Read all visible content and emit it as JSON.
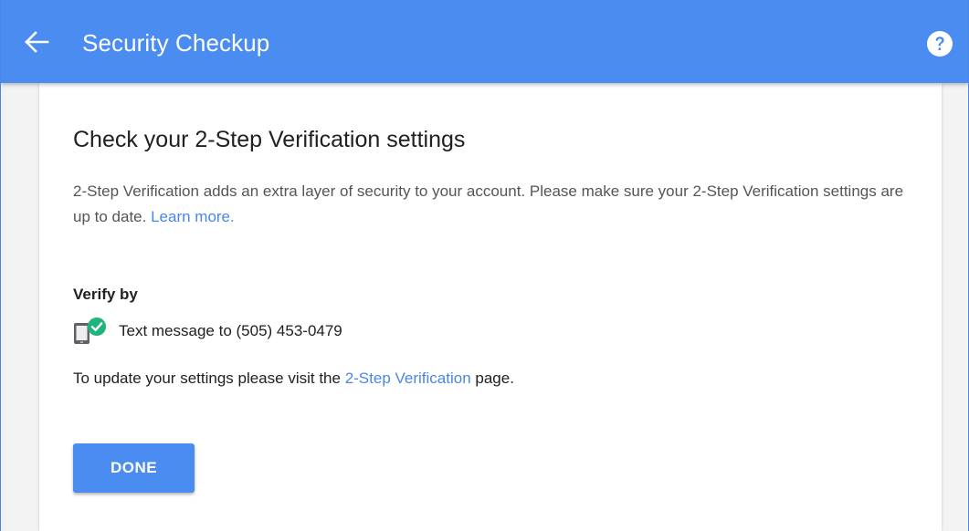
{
  "appbar": {
    "title": "Security Checkup",
    "back_icon": "arrow-left-icon",
    "help_icon": "help-circle-icon",
    "color": "#4b8cf0"
  },
  "card": {
    "heading": "Check your 2-Step Verification settings",
    "description": "2-Step Verification adds an extra layer of security to your account. Please make sure your 2-Step Verification settings are up to date. ",
    "learn_more_label": "Learn more.",
    "verify_by_label": "Verify by",
    "verify_method": {
      "icon": "phone-verified-icon",
      "text": "Text message to (505) 453-0479"
    },
    "update_prefix": "To update your settings please visit the ",
    "update_link": "2-Step Verification",
    "update_suffix": " page.",
    "done_label": "DONE"
  },
  "colors": {
    "accent": "#4b8cf0",
    "link": "#4a86e8",
    "check_green": "#1fb57a"
  }
}
